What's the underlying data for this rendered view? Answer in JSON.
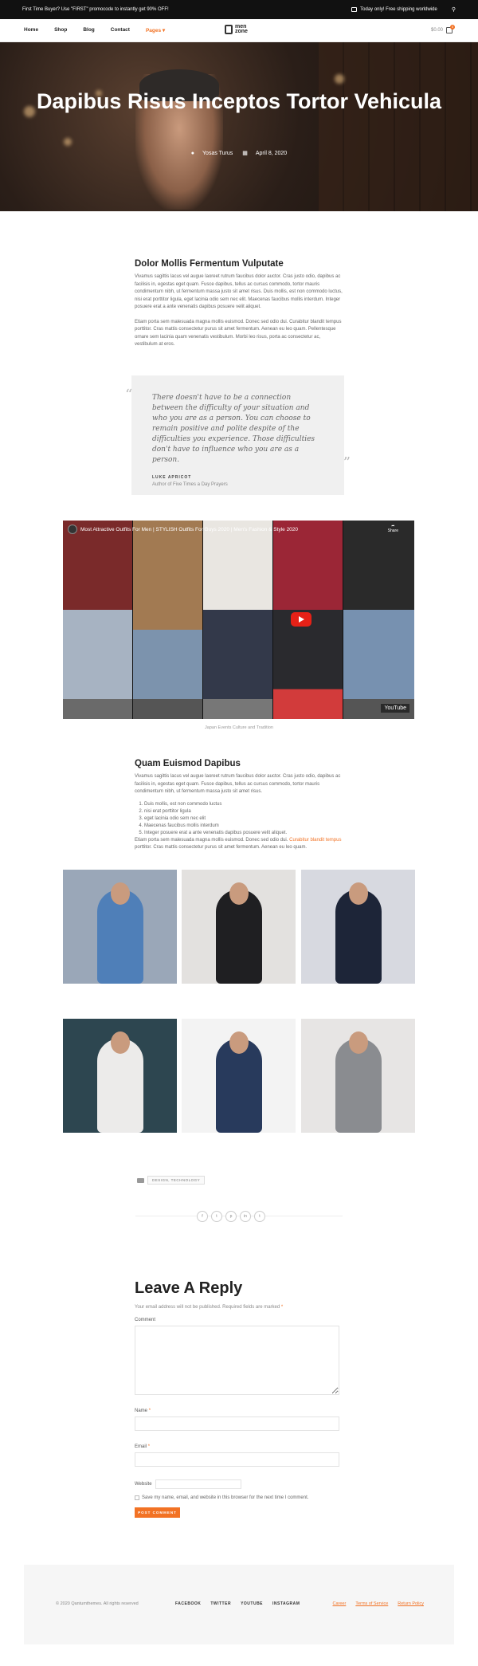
{
  "topbar": {
    "promo": "First Time Buyer? Use \"FIRST\" promocode to instantly get 90% OFF!",
    "shipping": "Today only! Free shipping worldwide",
    "search_icon": "search-icon"
  },
  "nav": {
    "items": [
      "Home",
      "Shop",
      "Blog",
      "Contact",
      "Pages ▾"
    ],
    "active_index": 4,
    "logo_line1": "men",
    "logo_line2": "zone",
    "cart_total": "$0.00",
    "cart_count": "0"
  },
  "hero": {
    "title": "Dapibus Risus Inceptos Tortor Vehicula",
    "author": "Yosas Turus",
    "date": "April 8, 2020"
  },
  "section1": {
    "heading": "Dolor Mollis Fermentum Vulputate",
    "p1": "Vivamus sagittis lacus vel augue laoreet rutrum faucibus dolor auctor. Cras justo odio, dapibus ac facilisis in, egestas eget quam. Fusce dapibus, tellus ac cursus commodo, tortor mauris condimentum nibh, ut fermentum massa justo sit amet risus. Duis mollis, est non commodo luctus, nisi erat porttitor ligula, eget lacinia odio sem nec elit. Maecenas faucibus mollis interdum. Integer posuere erat a ante venenatis dapibus posuere velit aliquet.",
    "p2": "Etiam porta sem malesuada magna mollis euismod. Donec sed odio dui. Curabitur blandit tempus porttitor. Cras mattis consectetur purus sit amet fermentum. Aenean eu leo quam. Pellentesque ornare sem lacinia quam venenatis vestibulum. Morbi leo risus, porta ac consectetur ac, vestibulum at eros."
  },
  "quote": {
    "text": "There doesn't have to be a connection between the difficulty of your situation and who you are as a person. You can choose to remain positive and polite despite of the difficulties you experience. Those difficulties don't have to influence who you are as a person.",
    "author": "LUKE APRICOT",
    "source": "Author of Five Times a Day Prayers"
  },
  "video": {
    "title": "Most Attractive Outfits For Men | STYLISH Outfits For Guys 2020 | Men's Fashion & Style 2020",
    "share_label": "Share",
    "yt_label": "YouTube",
    "caption": "Japan Events Culture and Tradition"
  },
  "section2": {
    "heading": "Quam Euismod Dapibus",
    "p1": "Vivamus sagittis lacus vel augue laoreet rutrum faucibus dolor auctor. Cras justo odio, dapibus ac facilisis in, egestas eget quam. Fusce dapibus, tellus ac cursus commodo, tortor mauris condimentum nibh, ut fermentum massa justo sit amet risus.",
    "list": [
      "Duis mollis, est non commodo luctus",
      "nisi erat porttitor ligula",
      "eget lacinia odio sem nec elit",
      "Maecenas faucibus mollis interdum",
      "Integer posuere erat a ante venenatis dapibus posuere velit aliquet."
    ],
    "p2_before": "Etiam porta sem malesuada magna mollis euismod. Donec sed odio dui. ",
    "p2_link": "Curabitur blandit tempus",
    "p2_after": " porttitor. Cras mattis consectetur purus sit amet fermentum. Aenean eu leo quam."
  },
  "gallery": {
    "colors": [
      "#9aa7b8",
      "#e3e1df",
      "#d7d9e0",
      "#2d4650",
      "#f3f3f3",
      "#e7e5e4"
    ],
    "shirts": [
      "#4f7fb8",
      "#1f1f22",
      "#1d2538",
      "#ecebea",
      "#283a5c",
      "#8a8c90"
    ]
  },
  "tags": {
    "text": "DESIGN, TECHNOLOGY"
  },
  "share": {
    "icons": [
      "f",
      "t",
      "p",
      "in",
      "t"
    ]
  },
  "reply": {
    "heading": "Leave A Reply",
    "note": "Your email address will not be published. Required fields are marked",
    "comment_label": "Comment",
    "name_label": "Name",
    "email_label": "Email",
    "website_label": "Website",
    "save_label": "Save my name, email, and website in this browser for the next time I comment.",
    "submit_label": "POST COMMENT"
  },
  "footer": {
    "copyright": "© 2020 Qantumthemes. All rights reserved",
    "socials": [
      "FACEBOOK",
      "TWITTER",
      "YOUTUBE",
      "INSTAGRAM"
    ],
    "legal": [
      "Career",
      "Terms of Service",
      "Return Policy"
    ]
  },
  "accent_color": "#f27224"
}
